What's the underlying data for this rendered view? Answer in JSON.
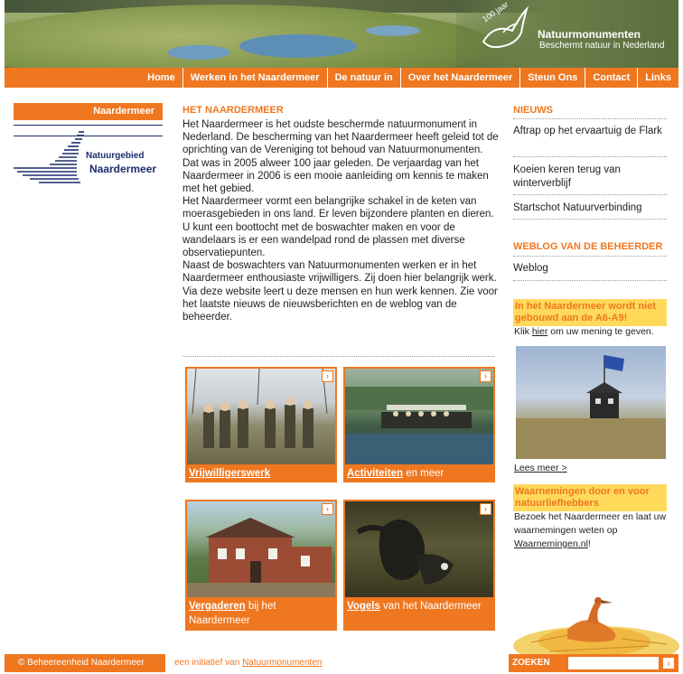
{
  "header": {
    "logo_years": "100 jaar",
    "logo_name": "Natuurmonumenten",
    "logo_tagline": "Beschermt natuur in Nederland"
  },
  "topnav": [
    "Home",
    "Werken in het Naardermeer",
    "De natuur in",
    "Over het Naardermeer",
    "Steun Ons",
    "Contact",
    "Links"
  ],
  "leftnav": {
    "title": "Naardermeer",
    "logo_line1": "Natuurgebied",
    "logo_line2": "Naardermeer"
  },
  "main": {
    "title": "HET NAARDERMEER",
    "paragraphs": [
      "Het Naardermeer is het oudste beschermde natuurmonument in Nederland. De bescherming van het Naardermeer heeft geleid tot de oprichting van de Vereniging tot behoud van Natuurmonumenten. Dat was in 2005 alweer 100 jaar geleden. De verjaardag van het Naardermeer in 2006 is een mooie aanleiding om kennis te maken met het gebied.",
      "Het Naardermeer vormt een belangrijke schakel in de keten van moerasgebieden in ons land. Er leven bijzondere planten en dieren. U kunt een boottocht met de boswachter maken en voor de wandelaars is er een wandelpad rond de plassen met diverse observatiepunten.",
      "Naast de boswachters van Natuurmonumenten werken er in het Naardermeer enthousiaste vrijwilligers. Zij doen hier belangrijk werk. Via deze website leert u deze mensen en hun werk kennen. Zie voor het laatste nieuws de nieuwsberichten en de weblog van de beheerder."
    ],
    "tiles": [
      {
        "link": "Vrijwilligerswerk",
        "rest": ""
      },
      {
        "link": "Activiteiten",
        "rest": " en meer"
      },
      {
        "link": "Vergaderen",
        "rest": " bij het Naardermeer"
      },
      {
        "link": "Vogels",
        "rest": " van het Naardermeer"
      }
    ]
  },
  "right": {
    "news_title": "NIEUWS",
    "news": [
      "Aftrap op het ervaartuig de Flark",
      "Koeien keren terug van winterverblijf",
      "Startschot Natuurverbinding"
    ],
    "weblog_title": "WEBLOG VAN DE BEHEERDER",
    "weblog_link": "Weblog",
    "campaign_title": "In het Naardermeer wordt niet gebouwd aan de A6-A9!",
    "campaign_pre": "Klik ",
    "campaign_link": "hier",
    "campaign_post": " om uw mening te geven.",
    "read_more": "Lees meer >",
    "obs_title": "Waarnemingen door en voor natuurliefhebbers",
    "obs_text": "Bezoek het Naardermeer en laat uw waarnemingen weten op ",
    "obs_link": "Waarnemingen.nl",
    "obs_end": "!"
  },
  "footer": {
    "copyright": "© Beheereenheid Naardermeer",
    "initiative_pre": "een initiatief van ",
    "initiative_link": "Natuurmonumenten",
    "search_label": "ZOEKEN",
    "search_value": ""
  },
  "colors": {
    "accent": "#ef7720",
    "highlight": "#ffd95a",
    "navy": "#1a2d6b"
  }
}
